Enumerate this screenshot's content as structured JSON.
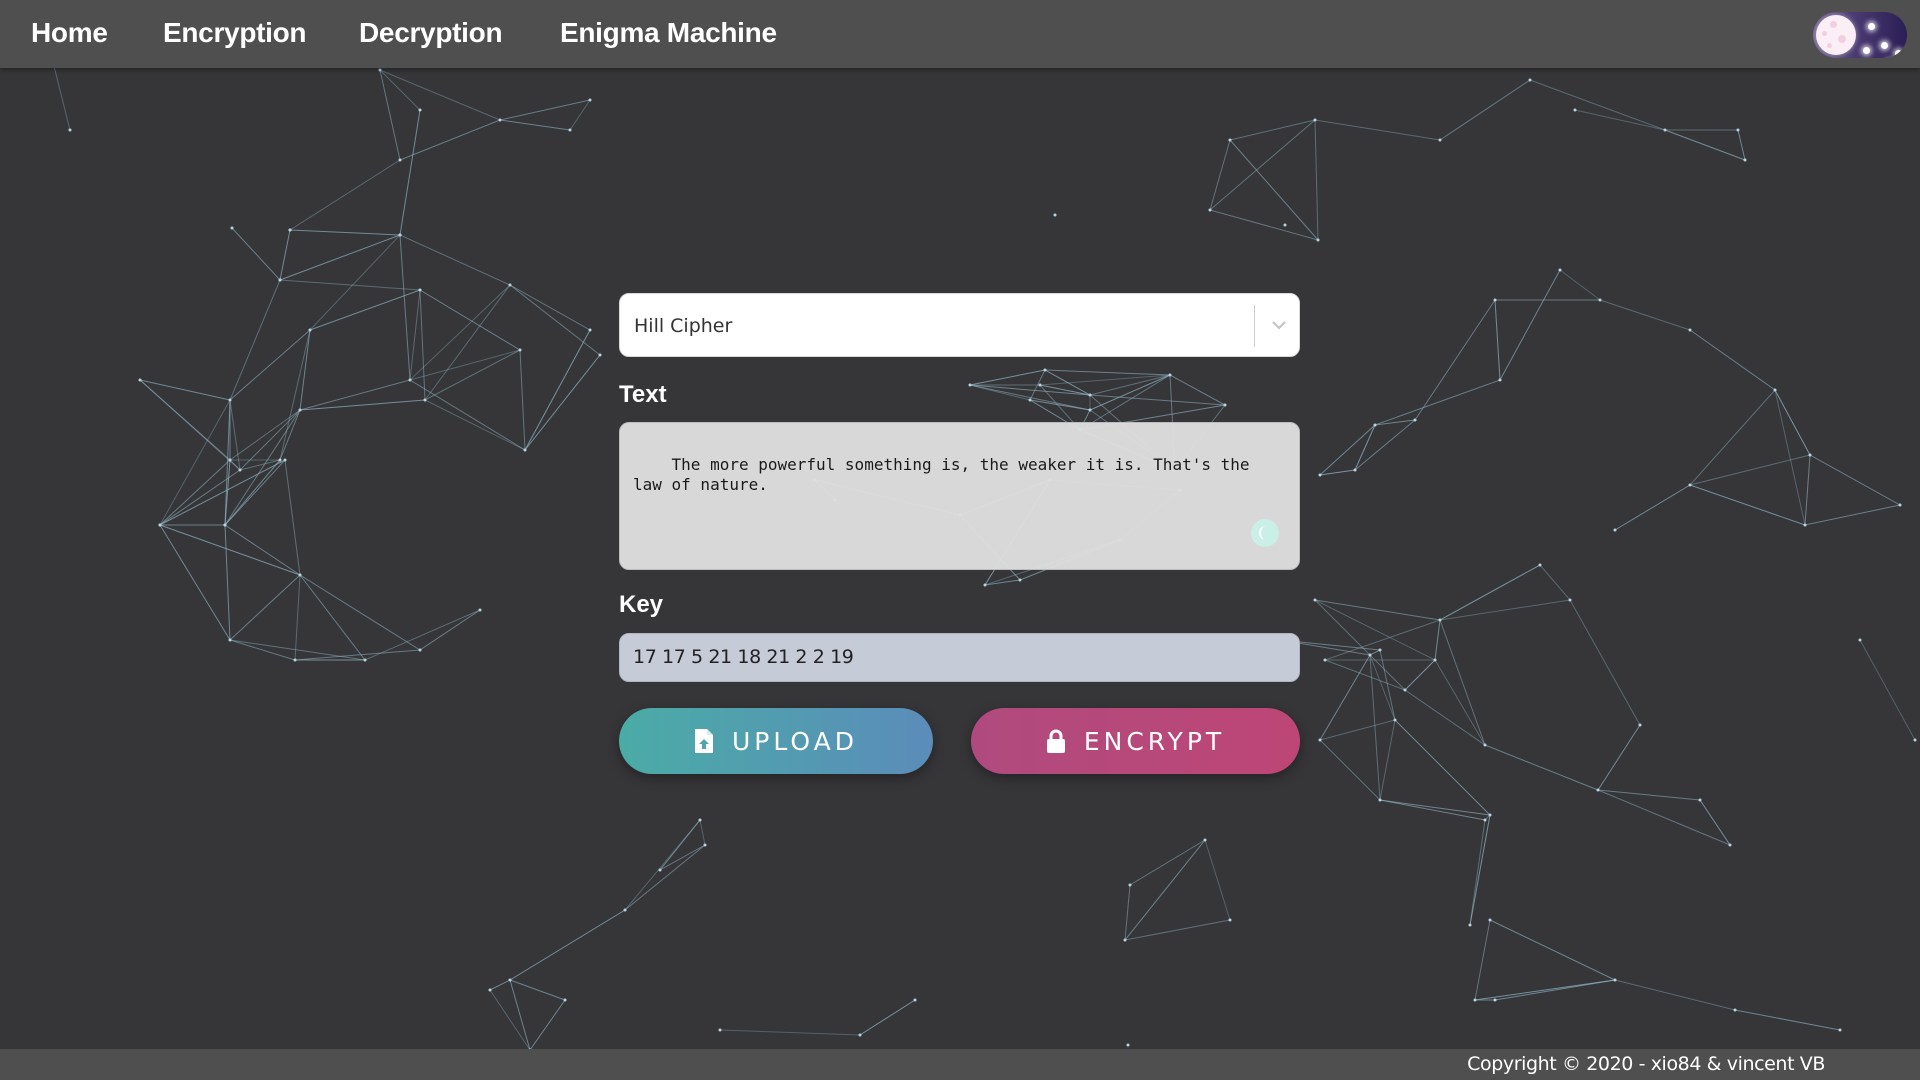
{
  "nav": {
    "items": [
      {
        "label": "Home"
      },
      {
        "label": "Encryption"
      },
      {
        "label": "Decryption"
      },
      {
        "label": "Enigma Machine"
      }
    ],
    "theme_toggle": {
      "icon": "moon-night-toggle-icon",
      "state": "dark"
    }
  },
  "form": {
    "cipher_select": {
      "selected": "Hill Cipher",
      "icon": "chevron-down-icon"
    },
    "text_label": "Text",
    "text_value": "The more powerful something is, the weaker it is. That's the law of nature.",
    "key_label": "Key",
    "key_value": "17 17 5 21 18 21 2 2 19",
    "upload_button": {
      "label": "UPLOAD",
      "icon": "file-upload-icon"
    },
    "encrypt_button": {
      "label": "ENCRYPT",
      "icon": "lock-icon"
    }
  },
  "footer": {
    "copyright": "Copyright © 2020 - xio84 & vincent VB"
  },
  "colors": {
    "background": "#363638",
    "navbar": "#4f4f4f",
    "upload_gradient_start": "#4aaca6",
    "upload_gradient_end": "#5b8cba",
    "encrypt": "#b84878",
    "key_input_bg": "#c5cbd7",
    "network_lines": "#8fb3c4"
  }
}
